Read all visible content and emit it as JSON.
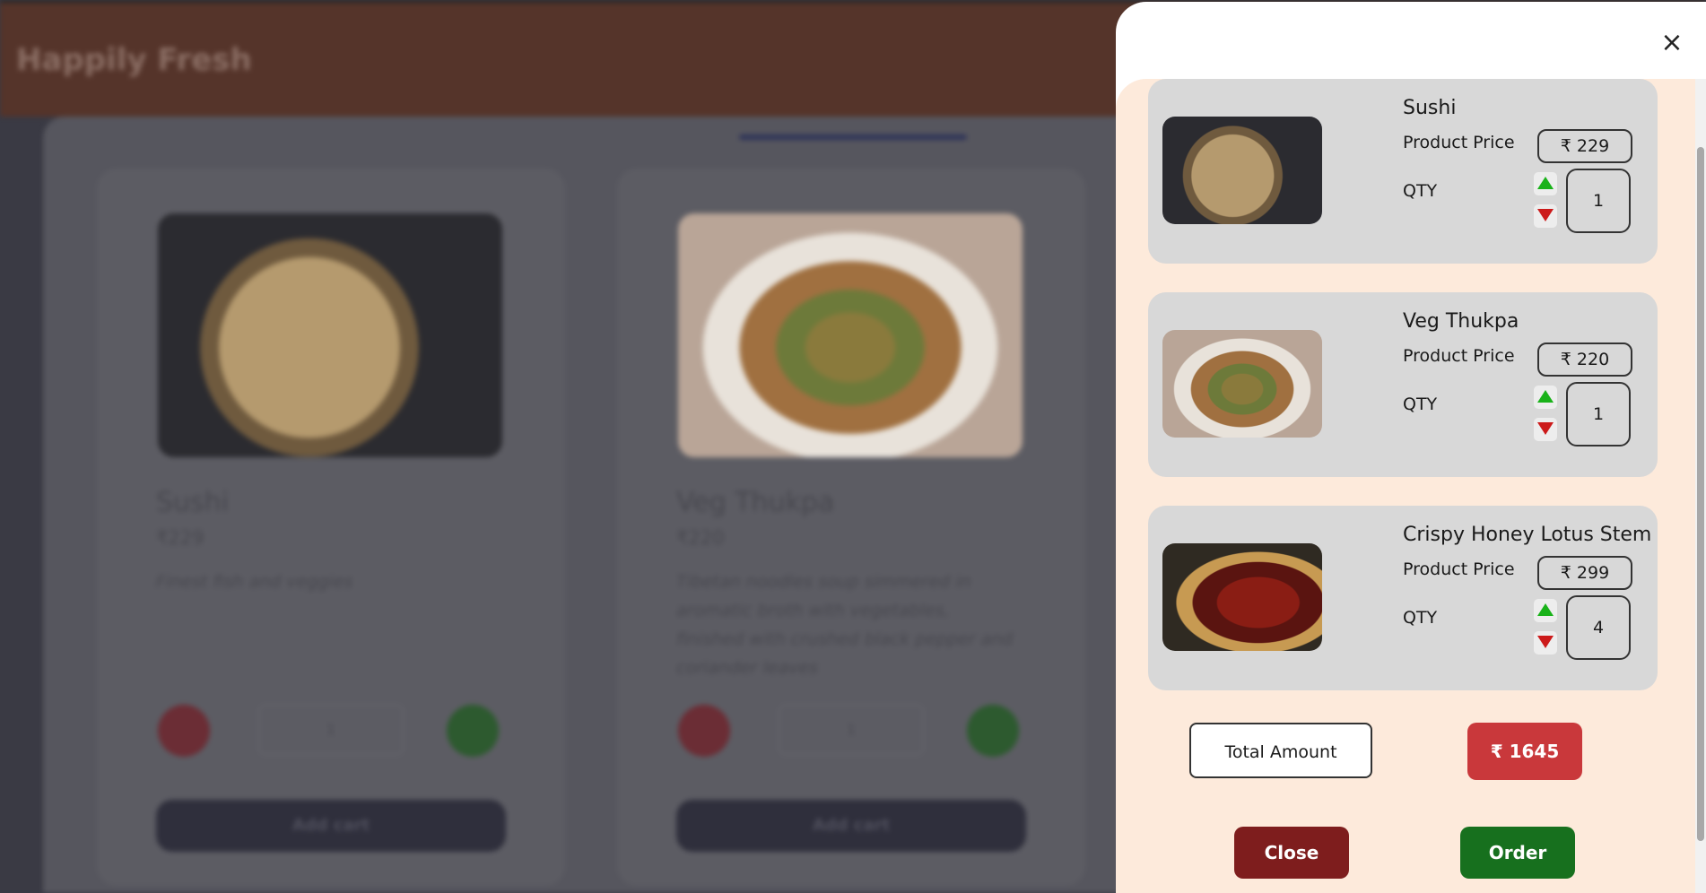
{
  "app": {
    "brand": "Happily Fresh"
  },
  "menu": {
    "cards": [
      {
        "name": "Sushi",
        "price": "₹229",
        "description": "Finest fish and veggies",
        "qty": "1",
        "add_label": "Add cart"
      },
      {
        "name": "Veg Thukpa",
        "price": "₹220",
        "description": "Tibetan noodles soup simmered in aromatic broth with vegetables, finished with crushed black pepper and coriander leaves",
        "qty": "1",
        "add_label": "Add cart"
      }
    ],
    "minus_label": "-",
    "plus_label": "+"
  },
  "cart": {
    "close_icon": "×",
    "price_label": "Product Price",
    "qty_label": "QTY",
    "items": [
      {
        "name": "Sushi",
        "price": "₹ 229",
        "qty": "1"
      },
      {
        "name": "Veg Thukpa",
        "price": "₹ 220",
        "qty": "1"
      },
      {
        "name": "Crispy Honey Lotus Stem",
        "price": "₹ 299",
        "qty": "4"
      }
    ],
    "total_label": "Total Amount",
    "total_value": "₹ 1645",
    "close_button": "Close",
    "order_button": "Order"
  },
  "colors": {
    "drawer_background": "#fdeadb",
    "total_badge": "#c9383b",
    "close_button": "#7e1d1d",
    "order_button": "#17701e",
    "arrow_up": "#19b219",
    "arrow_down": "#cc1a1a"
  }
}
